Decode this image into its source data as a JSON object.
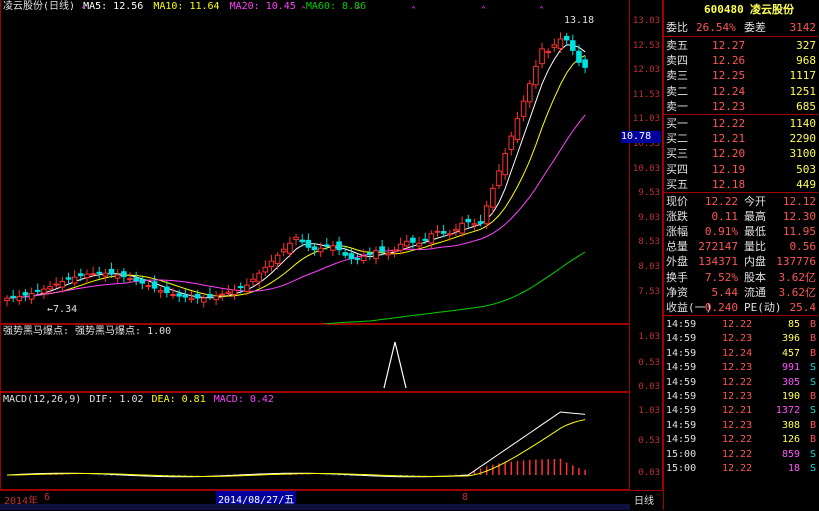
{
  "main": {
    "header": {
      "name": "凌云股份(日线)",
      "ma5": "MA5: 12.56",
      "ma10": "MA10: 11.64",
      "ma20": "MA20: 10.45",
      "ma60": "MA60: 8.86"
    },
    "high_label": "13.18",
    "low_label": "7.34",
    "y_ticks": [
      "13.03",
      "12.53",
      "12.03",
      "11.53",
      "11.03",
      "10.53",
      "10.03",
      "9.53",
      "9.03",
      "8.53",
      "8.03",
      "7.53"
    ],
    "current_price_label": "10.78"
  },
  "signal": {
    "header": "强势黑马爆点: 强势黑马爆点: 1.00",
    "y_ticks": [
      "1.03",
      "0.53",
      "0.03"
    ]
  },
  "macd": {
    "header": {
      "params": "MACD(12,26,9)",
      "dif": "DIF: 1.02",
      "dea": "DEA: 0.81",
      "macd": "MACD: 0.42"
    },
    "y_ticks": [
      "1.03",
      "0.53",
      "0.03"
    ]
  },
  "footer": {
    "year": "2014年",
    "month6": "6",
    "date_box": "2014/08/27/五",
    "month8": "8",
    "period": "日线"
  },
  "quote": {
    "code": "600480",
    "name": "凌云股份",
    "ratio_label": "委比",
    "ratio_value": "26.54%",
    "diff_label": "委差",
    "diff_value": "3142",
    "asks": [
      {
        "label": "卖五",
        "price": "12.27",
        "vol": "327"
      },
      {
        "label": "卖四",
        "price": "12.26",
        "vol": "968"
      },
      {
        "label": "卖三",
        "price": "12.25",
        "vol": "1117"
      },
      {
        "label": "卖二",
        "price": "12.24",
        "vol": "1251"
      },
      {
        "label": "卖一",
        "price": "12.23",
        "vol": "685"
      }
    ],
    "bids": [
      {
        "label": "买一",
        "price": "12.22",
        "vol": "1140"
      },
      {
        "label": "买二",
        "price": "12.21",
        "vol": "2290"
      },
      {
        "label": "买三",
        "price": "12.20",
        "vol": "3100"
      },
      {
        "label": "买四",
        "price": "12.19",
        "vol": "503"
      },
      {
        "label": "买五",
        "price": "12.18",
        "vol": "449"
      }
    ],
    "stats": [
      {
        "l1": "现价",
        "v1": "12.22",
        "l2": "今开",
        "v2": "12.12"
      },
      {
        "l1": "涨跌",
        "v1": "0.11",
        "l2": "最高",
        "v2": "12.30"
      },
      {
        "l1": "涨幅",
        "v1": "0.91%",
        "l2": "最低",
        "v2": "11.95"
      },
      {
        "l1": "总量",
        "v1": "272147",
        "l2": "量比",
        "v2": "0.56"
      },
      {
        "l1": "外盘",
        "v1": "134371",
        "l2": "内盘",
        "v2": "137776"
      },
      {
        "l1": "换手",
        "v1": "7.52%",
        "l2": "股本",
        "v2": "3.62亿"
      },
      {
        "l1": "净资",
        "v1": "5.44",
        "l2": "流通",
        "v2": "3.62亿"
      },
      {
        "l1": "收益(一)",
        "v1": "0.240",
        "l2": "PE(动)",
        "v2": "25.4"
      }
    ],
    "ticks": [
      {
        "time": "14:59",
        "price": "12.22",
        "vol": "85",
        "bs": "B"
      },
      {
        "time": "14:59",
        "price": "12.23",
        "vol": "396",
        "bs": "B"
      },
      {
        "time": "14:59",
        "price": "12.24",
        "vol": "457",
        "bs": "B"
      },
      {
        "time": "14:59",
        "price": "12.23",
        "vol": "991",
        "bs": "S"
      },
      {
        "time": "14:59",
        "price": "12.22",
        "vol": "305",
        "bs": "S"
      },
      {
        "time": "14:59",
        "price": "12.23",
        "vol": "190",
        "bs": "B"
      },
      {
        "time": "14:59",
        "price": "12.21",
        "vol": "1372",
        "bs": "S"
      },
      {
        "time": "14:59",
        "price": "12.23",
        "vol": "308",
        "bs": "B"
      },
      {
        "time": "14:59",
        "price": "12.22",
        "vol": "126",
        "bs": "B"
      },
      {
        "time": "15:00",
        "price": "12.22",
        "vol": "859",
        "bs": "S"
      },
      {
        "time": "15:00",
        "price": "12.22",
        "vol": "18",
        "bs": "S"
      }
    ]
  },
  "colors": {
    "up": "#ff3030",
    "down": "#00e0e0",
    "ma5": "#ffffff",
    "ma10": "#ffff00",
    "ma20": "#ff40ff",
    "ma60": "#00d000",
    "frame": "#a00000"
  }
}
